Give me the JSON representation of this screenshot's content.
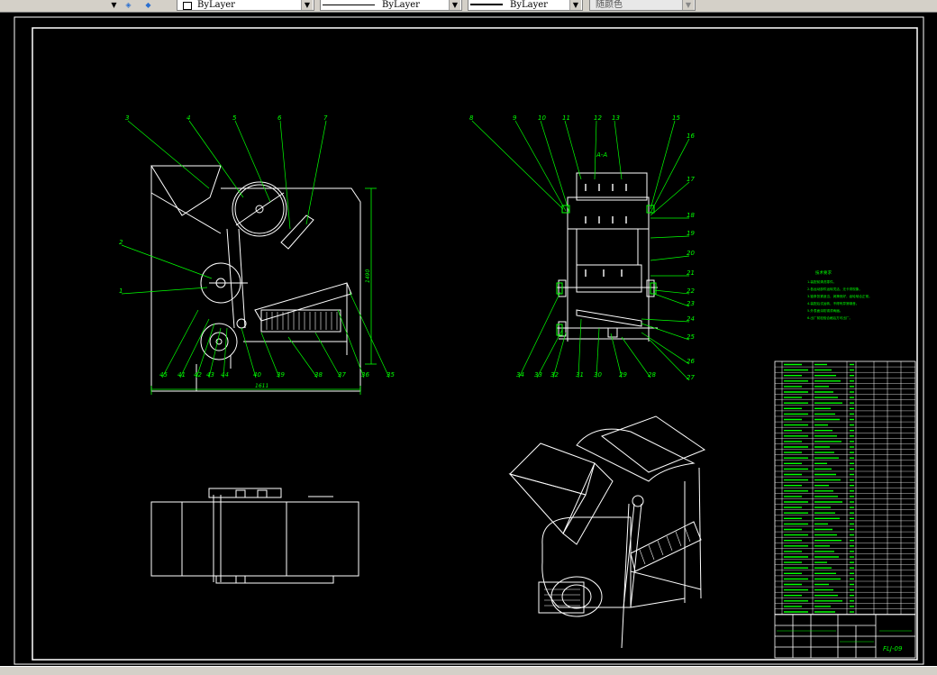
{
  "toolbar": {
    "layer_combo_value": "ByLayer",
    "linetype_combo_value": "ByLayer",
    "lineweight_combo_value": "ByLayer",
    "color_combo_value": "随颜色"
  },
  "drawing": {
    "front_labels_top": [
      "3",
      "4",
      "5",
      "6",
      "7"
    ],
    "front_labels_left": [
      "2",
      "1"
    ],
    "front_labels_bottom": [
      "45",
      "41",
      "42",
      "43",
      "44",
      "40",
      "39",
      "38",
      "37",
      "36",
      "35"
    ],
    "front_dim_width": "1611",
    "front_dim_height": "1490",
    "section_title": "A-A",
    "section_labels_top": [
      "8",
      "9",
      "10",
      "11",
      "12",
      "13",
      "15"
    ],
    "section_labels_right": [
      "16",
      "17",
      "18",
      "19",
      "20",
      "21",
      "22",
      "23",
      "24",
      "25",
      "26",
      "27"
    ],
    "section_labels_bottom": [
      "34",
      "33",
      "32",
      "31",
      "30",
      "29",
      "28"
    ],
    "notes_title": "技术要求",
    "notes": [
      "1.装配前清洗零件。",
      "2.各运动部件运转灵活，无卡滞现象。",
      "3.链条张紧适当，润滑良好，齿轮啮合正常。",
      "4.装配后试运转，不得有异常噪音。",
      "5.外表面涂防锈漆两遍。",
      "6.出厂前检验合格后方可出厂。"
    ],
    "drawing_number": "FLJ-09"
  },
  "colors": {
    "background": "#000000",
    "outline": "#ffffff",
    "leader": "#00ff00",
    "dimension": "#00ff00"
  }
}
